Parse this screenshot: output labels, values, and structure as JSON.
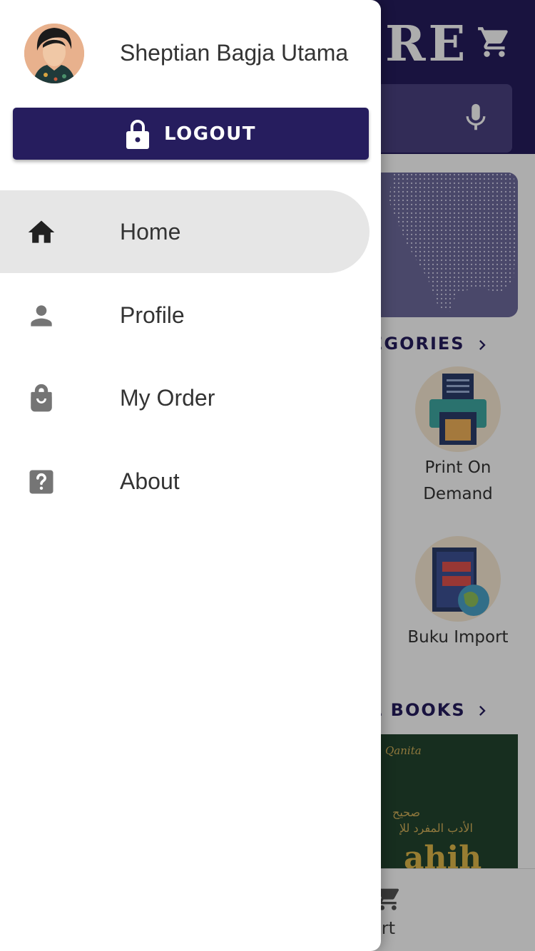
{
  "app": {
    "title": "RE",
    "categories_label": "EGORIES",
    "books_label": "L BOOKS",
    "categories": [
      {
        "label_line1": "Print On",
        "label_line2": "Demand",
        "icon": "printer-icon"
      },
      {
        "label_line1": "Buku Import",
        "label_line2": "",
        "icon": "book-globe-icon"
      }
    ],
    "book": {
      "logo_text": "Qanita",
      "arabic_line1": "صحيح",
      "arabic_line2": "الأدب المفرد للإ",
      "title_fragment": "ahih"
    },
    "bottom_nav": {
      "cart_label": "art"
    },
    "colors": {
      "primary": "#261d5e",
      "scrim": "rgba(0,0,0,0.32)"
    }
  },
  "drawer": {
    "user_name": "Sheptian Bagja Utama",
    "logout_label": "LOGOUT",
    "menu": [
      {
        "label": "Home",
        "icon": "home-icon",
        "active": true
      },
      {
        "label": "Profile",
        "icon": "person-icon",
        "active": false
      },
      {
        "label": "My Order",
        "icon": "shopping-bag-icon",
        "active": false
      },
      {
        "label": "About",
        "icon": "help-icon",
        "active": false
      }
    ]
  }
}
